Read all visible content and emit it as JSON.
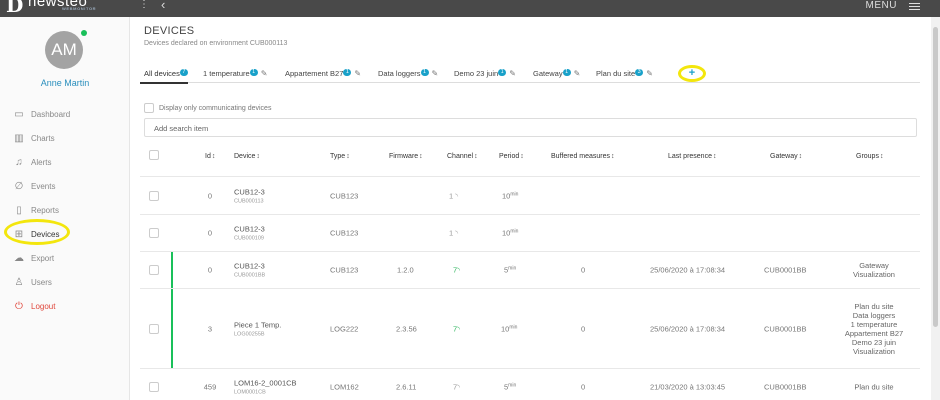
{
  "topbar": {
    "logo_text": "newsteo",
    "logo_sub": "WEBMONITOR",
    "menu_label": "MENU"
  },
  "user": {
    "initials": "AM",
    "name": "Anne Martin"
  },
  "nav": [
    {
      "label": "Dashboard",
      "icon": "monitor-icon",
      "active": false
    },
    {
      "label": "Charts",
      "icon": "chart-icon",
      "active": false
    },
    {
      "label": "Alerts",
      "icon": "bell-icon",
      "active": false
    },
    {
      "label": "Events",
      "icon": "paperclip-icon",
      "active": false
    },
    {
      "label": "Reports",
      "icon": "report-icon",
      "active": false
    },
    {
      "label": "Devices",
      "icon": "grid-icon",
      "active": true
    },
    {
      "label": "Export",
      "icon": "cloud-upload-icon",
      "active": false
    },
    {
      "label": "Users",
      "icon": "user-icon",
      "active": false
    },
    {
      "label": "Logout",
      "icon": "power-icon",
      "active": false
    }
  ],
  "page": {
    "title": "DEVICES",
    "subtitle": "Devices declared on environment CUB000113"
  },
  "tabs": [
    {
      "label": "All devices",
      "count": "7"
    },
    {
      "label": "1 temperature",
      "count": "1"
    },
    {
      "label": "Appartement B27",
      "count": "1"
    },
    {
      "label": "Data loggers",
      "count": "1"
    },
    {
      "label": "Demo 23 juin",
      "count": "1"
    },
    {
      "label": "Gateway",
      "count": "1"
    },
    {
      "label": "Plan du site",
      "count": "3"
    }
  ],
  "add_tab_label": "+",
  "filter": {
    "only_communicating_label": "Display only communicating devices",
    "search_placeholder": "Add search item"
  },
  "columns": {
    "id": "Id",
    "device": "Device",
    "type": "Type",
    "firmware": "Firmware",
    "channel": "Channel",
    "period": "Period",
    "buffered": "Buffered measures",
    "last_presence": "Last presence",
    "gateway": "Gateway",
    "groups": "Groups"
  },
  "sort_glyph": "↕",
  "rows": [
    {
      "id": "0",
      "device": "CUB12-3",
      "serial": "CUB000113",
      "type": "CUB123",
      "firmware": "",
      "channel": "1",
      "channel_status": "gray",
      "period": "10",
      "period_unit": "min",
      "buffered": "",
      "last_presence": "",
      "gateway": "",
      "groups": [],
      "status_bar": false
    },
    {
      "id": "0",
      "device": "CUB12-3",
      "serial": "CUB000109",
      "type": "CUB123",
      "firmware": "",
      "channel": "1",
      "channel_status": "gray",
      "period": "10",
      "period_unit": "min",
      "buffered": "",
      "last_presence": "",
      "gateway": "",
      "groups": [],
      "status_bar": false
    },
    {
      "id": "0",
      "device": "CUB12-3",
      "serial": "CUB0001BB",
      "type": "CUB123",
      "firmware": "1.2.0",
      "channel": "7",
      "channel_status": "green",
      "period": "5",
      "period_unit": "min",
      "buffered": "0",
      "last_presence": "25/06/2020 à 17:08:34",
      "gateway": "CUB0001BB",
      "groups": [
        "Gateway",
        "Visualization"
      ],
      "status_bar": true
    },
    {
      "id": "3",
      "device": "Piece 1 Temp.",
      "serial": "LOG00255B",
      "type": "LOG222",
      "firmware": "2.3.56",
      "channel": "7",
      "channel_status": "green",
      "period": "10",
      "period_unit": "min",
      "buffered": "0",
      "last_presence": "25/06/2020 à 17:08:34",
      "gateway": "CUB0001BB",
      "groups": [
        "Plan du site",
        "Data loggers",
        "1 temperature",
        "Appartement B27",
        "Demo 23 juin",
        "Visualization"
      ],
      "status_bar": true
    },
    {
      "id": "459",
      "device": "LOM16-2_0001CB",
      "serial": "LOM0001CB",
      "type": "LOM162",
      "firmware": "2.6.11",
      "channel": "7",
      "channel_status": "gray",
      "period": "5",
      "period_unit": "min",
      "buffered": "0",
      "last_presence": "21/03/2020 à 13:03:45",
      "gateway": "CUB0001BB",
      "groups": [
        "Plan du site"
      ],
      "status_bar": false
    }
  ],
  "colors": {
    "accent": "#19a1c9",
    "status_green": "#19c05a",
    "logout_red": "#e0473c",
    "highlight_yellow": "#f3e60d",
    "topbar": "#494949"
  }
}
